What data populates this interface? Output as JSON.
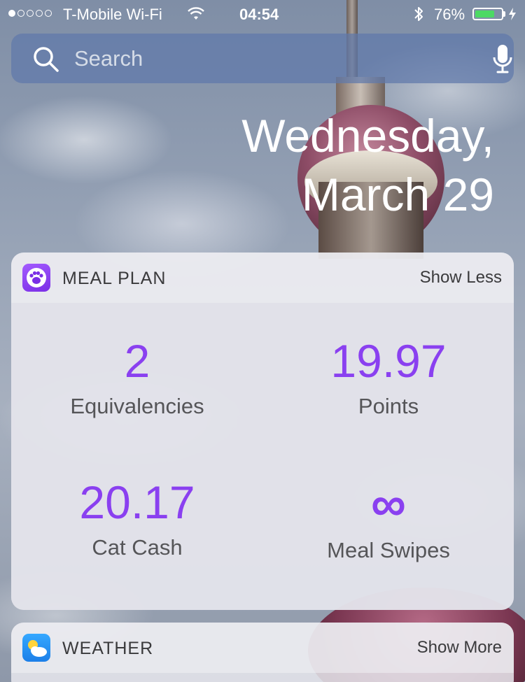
{
  "status_bar": {
    "signal_bars": 1,
    "carrier": "T-Mobile Wi-Fi",
    "time": "04:54",
    "battery_percent_label": "76%",
    "battery_level": 0.76,
    "battery_color": "#4cd964"
  },
  "search": {
    "placeholder": "Search"
  },
  "date": {
    "line1": "Wednesday,",
    "line2": "March 29"
  },
  "meal_plan_widget": {
    "title": "MEAL PLAN",
    "toggle_label": "Show Less",
    "accent_color": "#8a40f0",
    "stats": [
      {
        "value": "2",
        "label": "Equivalencies"
      },
      {
        "value": "19.97",
        "label": "Points"
      },
      {
        "value": "20.17",
        "label": "Cat Cash"
      },
      {
        "value": "∞",
        "label": "Meal Swipes"
      }
    ]
  },
  "weather_widget": {
    "title": "WEATHER",
    "toggle_label": "Show More"
  }
}
